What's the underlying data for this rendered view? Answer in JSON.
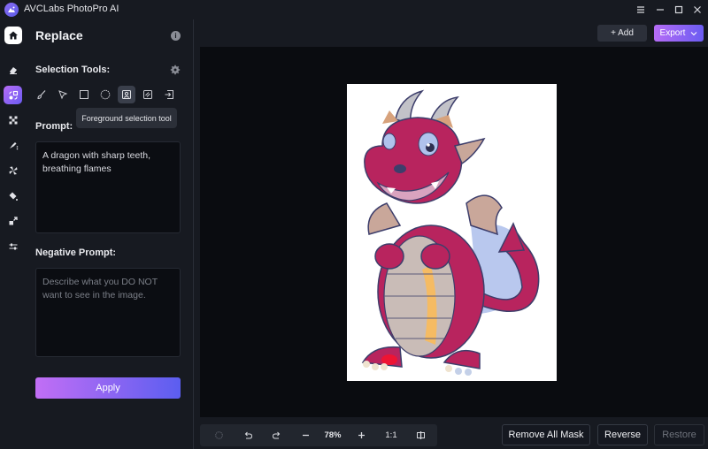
{
  "window": {
    "title": "AVCLabs PhotoPro AI",
    "controls": [
      "menu",
      "minimize",
      "maximize",
      "close"
    ]
  },
  "rail": {
    "items": [
      {
        "name": "home",
        "icon": "home-icon",
        "active": false
      },
      {
        "name": "erase",
        "icon": "eraser-icon",
        "active": false
      },
      {
        "name": "replace",
        "icon": "replace-icon",
        "active": true
      },
      {
        "name": "expand",
        "icon": "expand-icon",
        "active": false
      },
      {
        "name": "colorize",
        "icon": "brush-sparkle-icon",
        "active": false
      },
      {
        "name": "enhance",
        "icon": "fan-icon",
        "active": false
      },
      {
        "name": "fill",
        "icon": "paint-bucket-icon",
        "active": false
      },
      {
        "name": "upscale",
        "icon": "resize-icon",
        "active": false
      },
      {
        "name": "adjust",
        "icon": "sliders-icon",
        "active": false
      }
    ]
  },
  "panel": {
    "title": "Replace",
    "selection_tools_label": "Selection Tools:",
    "tools": [
      {
        "name": "brush",
        "icon": "brush-icon"
      },
      {
        "name": "lasso",
        "icon": "pointer-icon"
      },
      {
        "name": "rectangle",
        "icon": "rectangle-select-icon"
      },
      {
        "name": "ellipse",
        "icon": "ellipse-select-icon"
      },
      {
        "name": "foreground",
        "icon": "person-frame-icon",
        "active": true
      },
      {
        "name": "background",
        "icon": "hatch-frame-icon"
      },
      {
        "name": "import",
        "icon": "import-icon"
      }
    ],
    "tooltip": "Foreground selection tool",
    "prompt_label": "Prompt:",
    "prompt_value": "A dragon with sharp teeth, breathing flames",
    "negative_prompt_label": "Negative Prompt:",
    "negative_prompt_placeholder": "Describe what you DO NOT want to see in the image.",
    "apply_label": "Apply"
  },
  "header": {
    "add_label": "+ Add",
    "export_label": "Export"
  },
  "zoombar": {
    "zoom_level": "78%",
    "actual_size_label": "1:1"
  },
  "actions": {
    "remove_all_mask": "Remove All Mask",
    "reverse": "Reverse",
    "restore": "Restore"
  },
  "colors": {
    "accent_start": "#c26ef5",
    "accent_end": "#5b5ef0",
    "background": "#171a21",
    "canvas": "#0a0c10"
  }
}
